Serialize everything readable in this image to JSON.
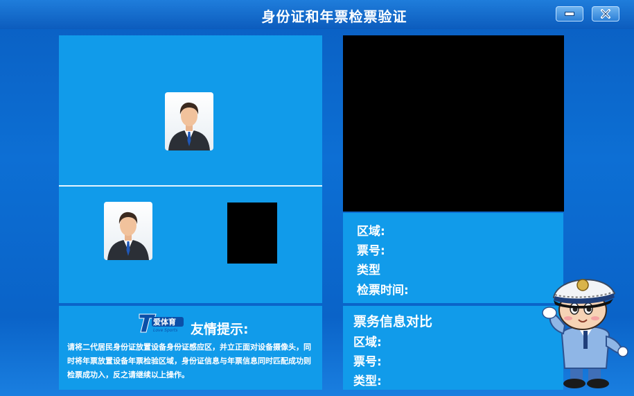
{
  "window": {
    "title": "身份证和年票检票验证",
    "minimize_icon": "minimize-icon",
    "close_icon": "close-icon"
  },
  "ticket_info": {
    "area_label": "区域:",
    "ticket_no_label": "票号:",
    "type_label": "类型",
    "check_time_label": "检票时间:"
  },
  "tips": {
    "logo_text": "T爱体育",
    "logo_subtext": "Love Sports",
    "title": "友情提示:",
    "body": "请将二代居民身份证放置设备身份证感应区，并立正面对设备摄像头，同时将年票放置设备年票检验区域，身份证信息与年票信息同时匹配成功则检票成功入，反之请继续以上操作。"
  },
  "compare": {
    "title": "票务信息对比",
    "area_label": "区域:",
    "ticket_no_label": "票号:",
    "type_label": "类型:"
  },
  "colors": {
    "background": "#0a63c8",
    "panel": "#119bea",
    "text": "#ffffff"
  }
}
